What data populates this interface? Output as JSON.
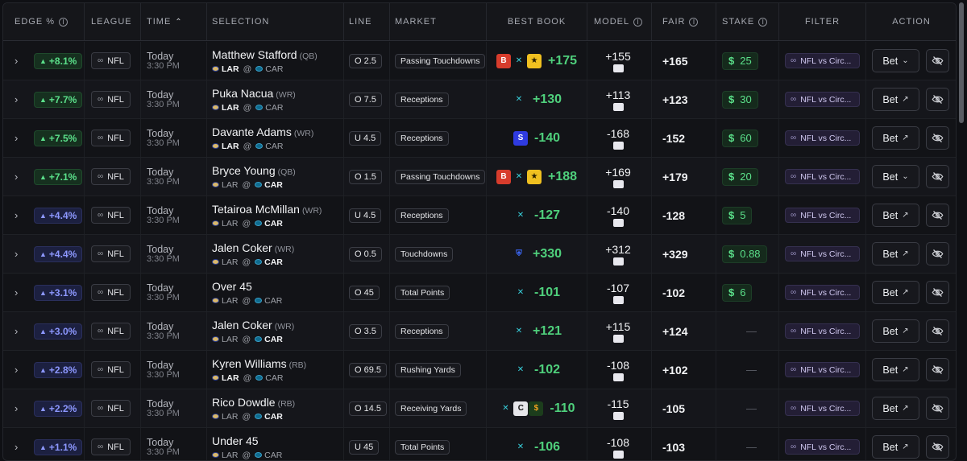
{
  "headers": {
    "edge": "EDGE %",
    "league": "LEAGUE",
    "time": "TIME",
    "selection": "SELECTION",
    "line": "LINE",
    "market": "MARKET",
    "best_book": "BEST BOOK",
    "model": "MODEL",
    "fair": "FAIR",
    "stake": "STAKE",
    "filter": "FILTER",
    "action": "ACTION"
  },
  "colors": {
    "positive": "#4fd07c",
    "edge_green": "#5be08a",
    "edge_blue": "#8d98ff",
    "filter_bg": "#231e35"
  },
  "rows": [
    {
      "edge": "+8.1%",
      "edge_tone": "g",
      "league": "NFL",
      "day": "Today",
      "time": "3:30 PM",
      "name": "Matthew Stafford",
      "pos": "(QB)",
      "home": "LAR",
      "away": "CAR",
      "strong": "home",
      "line": "O 2.5",
      "market": "Passing Touchdowns",
      "books": [
        "book-b-logo",
        "book-x-logo",
        "book-yellow-logo"
      ],
      "odds": "+175",
      "model": "+155",
      "fair": "+165",
      "stake": "25",
      "filter": "NFL vs Circ...",
      "bet": "Bet",
      "bet_icon": "chevron-down-icon"
    },
    {
      "edge": "+7.7%",
      "edge_tone": "g",
      "league": "NFL",
      "day": "Today",
      "time": "3:30 PM",
      "name": "Puka Nacua",
      "pos": "(WR)",
      "home": "LAR",
      "away": "CAR",
      "strong": "home",
      "line": "O 7.5",
      "market": "Receptions",
      "books": [
        "book-x-logo"
      ],
      "odds": "+130",
      "model": "+113",
      "fair": "+123",
      "stake": "30",
      "filter": "NFL vs Circ...",
      "bet": "Bet",
      "bet_icon": "external-link-icon"
    },
    {
      "edge": "+7.5%",
      "edge_tone": "g",
      "league": "NFL",
      "day": "Today",
      "time": "3:30 PM",
      "name": "Davante Adams",
      "pos": "(WR)",
      "home": "LAR",
      "away": "CAR",
      "strong": "home",
      "line": "U 4.5",
      "market": "Receptions",
      "books": [
        "book-s-logo"
      ],
      "odds": "-140",
      "model": "-168",
      "fair": "-152",
      "stake": "60",
      "filter": "NFL vs Circ...",
      "bet": "Bet",
      "bet_icon": "external-link-icon"
    },
    {
      "edge": "+7.1%",
      "edge_tone": "g",
      "league": "NFL",
      "day": "Today",
      "time": "3:30 PM",
      "name": "Bryce Young",
      "pos": "(QB)",
      "home": "LAR",
      "away": "CAR",
      "strong": "away",
      "line": "O 1.5",
      "market": "Passing Touchdowns",
      "books": [
        "book-b-logo",
        "book-x-logo",
        "book-yellow-logo"
      ],
      "odds": "+188",
      "model": "+169",
      "fair": "+179",
      "stake": "20",
      "filter": "NFL vs Circ...",
      "bet": "Bet",
      "bet_icon": "chevron-down-icon"
    },
    {
      "edge": "+4.4%",
      "edge_tone": "b",
      "league": "NFL",
      "day": "Today",
      "time": "3:30 PM",
      "name": "Tetairoa McMillan",
      "pos": "(WR)",
      "home": "LAR",
      "away": "CAR",
      "strong": "away",
      "line": "U 4.5",
      "market": "Receptions",
      "books": [
        "book-x-logo"
      ],
      "odds": "-127",
      "model": "-140",
      "fair": "-128",
      "stake": "5",
      "filter": "NFL vs Circ...",
      "bet": "Bet",
      "bet_icon": "external-link-icon"
    },
    {
      "edge": "+4.4%",
      "edge_tone": "b",
      "league": "NFL",
      "day": "Today",
      "time": "3:30 PM",
      "name": "Jalen Coker",
      "pos": "(WR)",
      "home": "LAR",
      "away": "CAR",
      "strong": "away",
      "line": "O 0.5",
      "market": "Touchdowns",
      "books": [
        "book-f-logo"
      ],
      "odds": "+330",
      "model": "+312",
      "fair": "+329",
      "stake": "0.88",
      "filter": "NFL vs Circ...",
      "bet": "Bet",
      "bet_icon": "external-link-icon"
    },
    {
      "edge": "+3.1%",
      "edge_tone": "b",
      "league": "NFL",
      "day": "Today",
      "time": "3:30 PM",
      "name": "Over 45",
      "pos": "",
      "home": "LAR",
      "away": "CAR",
      "strong": "",
      "line": "O 45",
      "market": "Total Points",
      "books": [
        "book-x-logo"
      ],
      "odds": "-101",
      "model": "-107",
      "fair": "-102",
      "stake": "6",
      "filter": "NFL vs Circ...",
      "bet": "Bet",
      "bet_icon": "external-link-icon"
    },
    {
      "edge": "+3.0%",
      "edge_tone": "b",
      "league": "NFL",
      "day": "Today",
      "time": "3:30 PM",
      "name": "Jalen Coker",
      "pos": "(WR)",
      "home": "LAR",
      "away": "CAR",
      "strong": "away",
      "line": "O 3.5",
      "market": "Receptions",
      "books": [
        "book-x-logo"
      ],
      "odds": "+121",
      "model": "+115",
      "fair": "+124",
      "stake": "—",
      "filter": "NFL vs Circ...",
      "bet": "Bet",
      "bet_icon": "external-link-icon"
    },
    {
      "edge": "+2.8%",
      "edge_tone": "b",
      "league": "NFL",
      "day": "Today",
      "time": "3:30 PM",
      "name": "Kyren Williams",
      "pos": "(RB)",
      "home": "LAR",
      "away": "CAR",
      "strong": "home",
      "line": "O 69.5",
      "market": "Rushing Yards",
      "books": [
        "book-x-logo"
      ],
      "odds": "-102",
      "model": "-108",
      "fair": "+102",
      "stake": "—",
      "filter": "NFL vs Circ...",
      "bet": "Bet",
      "bet_icon": "external-link-icon"
    },
    {
      "edge": "+2.2%",
      "edge_tone": "b",
      "league": "NFL",
      "day": "Today",
      "time": "3:30 PM",
      "name": "Rico Dowdle",
      "pos": "(RB)",
      "home": "LAR",
      "away": "CAR",
      "strong": "away",
      "line": "O 14.5",
      "market": "Receiving Yards",
      "books": [
        "book-x-logo",
        "book-circa-logo",
        "book-dk-logo"
      ],
      "odds": "-110",
      "model": "-115",
      "fair": "-105",
      "stake": "—",
      "filter": "NFL vs Circ...",
      "bet": "Bet",
      "bet_icon": "external-link-icon"
    },
    {
      "edge": "+1.1%",
      "edge_tone": "b",
      "league": "NFL",
      "day": "Today",
      "time": "3:30 PM",
      "name": "Under 45",
      "pos": "",
      "home": "LAR",
      "away": "CAR",
      "strong": "",
      "line": "U 45",
      "market": "Total Points",
      "books": [
        "book-x-logo"
      ],
      "odds": "-106",
      "model": "-108",
      "fair": "-103",
      "stake": "—",
      "filter": "NFL vs Circ...",
      "bet": "Bet",
      "bet_icon": "external-link-icon"
    }
  ]
}
